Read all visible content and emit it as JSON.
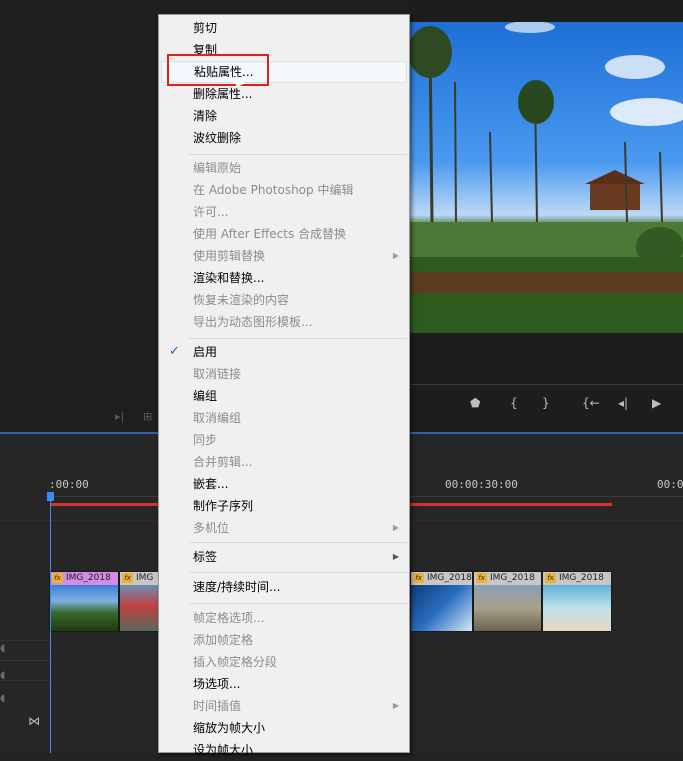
{
  "source_monitor": {
    "controls": [
      "▸|",
      "⊞"
    ]
  },
  "program_monitor": {
    "transport": [
      "⬟",
      "{",
      "}",
      "{←",
      "◂|",
      "▶"
    ]
  },
  "timeline": {
    "ruler_start": ":00:00",
    "ruler_mid": "00:00:30:00",
    "ruler_end": "00:0",
    "clips": [
      {
        "label": "IMG_2018"
      },
      {
        "label": "IMG"
      },
      {
        "label": "IMG_2018"
      },
      {
        "label": "IMG_2018"
      },
      {
        "label": "IMG_2018"
      }
    ],
    "fx_badge": "fx"
  },
  "context_menu": {
    "groups": [
      [
        {
          "label": "剪切",
          "enabled": true
        },
        {
          "label": "复制",
          "enabled": true
        },
        {
          "label": "粘贴属性...",
          "enabled": true,
          "hovered": true
        },
        {
          "label": "删除属性...",
          "enabled": true
        },
        {
          "label": "清除",
          "enabled": true
        },
        {
          "label": "波纹删除",
          "enabled": true
        }
      ],
      [
        {
          "label": "编辑原始",
          "enabled": false
        },
        {
          "label": "在 Adobe Photoshop 中编辑",
          "enabled": false
        },
        {
          "label": "许可...",
          "enabled": false
        },
        {
          "label": "使用 After Effects 合成替换",
          "enabled": false
        },
        {
          "label": "使用剪辑替换",
          "enabled": false,
          "submenu": true
        },
        {
          "label": "渲染和替换...",
          "enabled": true
        },
        {
          "label": "恢复未渲染的内容",
          "enabled": false
        },
        {
          "label": "导出为动态图形模板...",
          "enabled": false
        }
      ],
      [
        {
          "label": "启用",
          "enabled": true,
          "checked": true
        },
        {
          "label": "取消链接",
          "enabled": false
        },
        {
          "label": "编组",
          "enabled": true
        },
        {
          "label": "取消编组",
          "enabled": false
        },
        {
          "label": "同步",
          "enabled": false
        },
        {
          "label": "合并剪辑...",
          "enabled": false
        },
        {
          "label": "嵌套...",
          "enabled": true
        },
        {
          "label": "制作子序列",
          "enabled": true
        },
        {
          "label": "多机位",
          "enabled": false,
          "submenu": true
        }
      ],
      [
        {
          "label": "标签",
          "enabled": true,
          "submenu": true
        }
      ],
      [
        {
          "label": "速度/持续时间...",
          "enabled": true
        }
      ],
      [
        {
          "label": "帧定格选项...",
          "enabled": false
        },
        {
          "label": "添加帧定格",
          "enabled": false
        },
        {
          "label": "插入帧定格分段",
          "enabled": false
        },
        {
          "label": "场选项...",
          "enabled": true
        },
        {
          "label": "时间插值",
          "enabled": false,
          "submenu": true
        },
        {
          "label": "缩放为帧大小",
          "enabled": true
        },
        {
          "label": "设为帧大小",
          "enabled": true
        }
      ]
    ],
    "check_glyph": "✓",
    "submenu_glyph": "▶"
  },
  "colors": {
    "highlight_box": "#e2201d",
    "playhead": "#3a8df5",
    "work_area_bar": "#d8342a",
    "check": "#1c5fbf"
  }
}
